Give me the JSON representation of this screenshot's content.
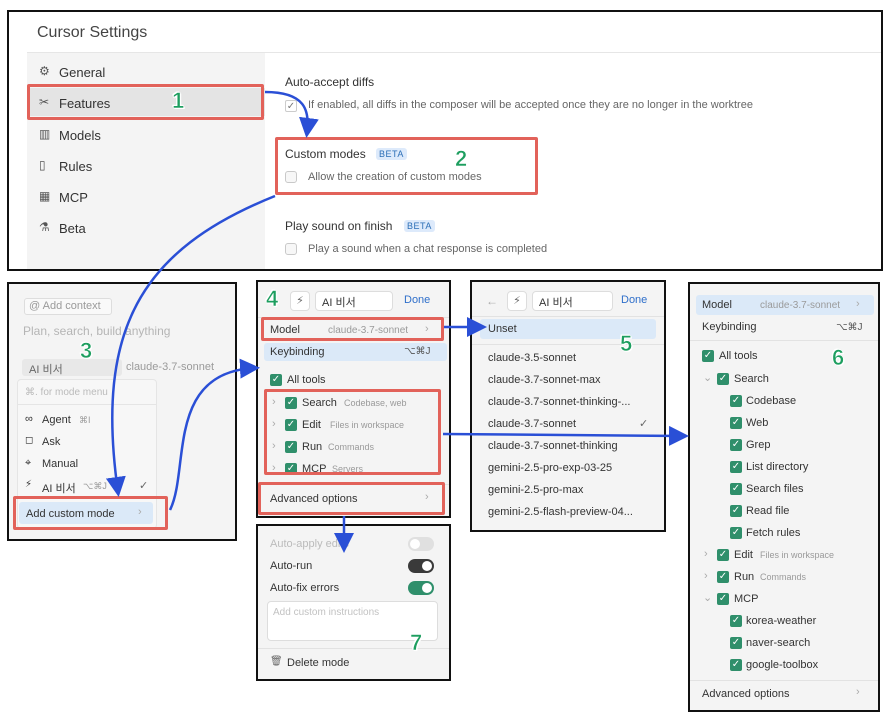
{
  "settings": {
    "title": "Cursor Settings",
    "sidebar": [
      {
        "icon": "⚙",
        "label": "General"
      },
      {
        "icon": "✂",
        "label": "Features"
      },
      {
        "icon": "▥",
        "label": "Models"
      },
      {
        "icon": "▯",
        "label": "Rules"
      },
      {
        "icon": "▦",
        "label": "MCP"
      },
      {
        "icon": "⚗",
        "label": "Beta"
      }
    ],
    "auto_accept": {
      "title": "Auto-accept diffs",
      "desc": "If enabled, all diffs in the composer will be accepted once they are no longer in the worktree"
    },
    "custom_modes": {
      "title": "Custom modes",
      "badge": "BETA",
      "desc": "Allow the creation of custom modes"
    },
    "play_sound": {
      "title": "Play sound on finish",
      "badge": "BETA",
      "desc": "Play a sound when a chat response is completed"
    }
  },
  "chat": {
    "add_context": "@ Add context",
    "placeholder": "Plan, search, build anything",
    "mode_button": "AI 비서",
    "model_button": "claude-3.7-sonnet",
    "menu_search": "⌘. for mode menu",
    "modes": [
      {
        "icon": "∞",
        "label": "Agent",
        "shortcut": "⌘I"
      },
      {
        "icon": "◻",
        "label": "Ask",
        "shortcut": ""
      },
      {
        "icon": "⌖",
        "label": "Manual",
        "shortcut": ""
      },
      {
        "icon": "⚡",
        "label": "AI 비서",
        "shortcut": "⌥⌘J"
      }
    ],
    "add_custom_mode": "Add custom mode"
  },
  "mode_editor": {
    "name": "AI 비서",
    "done": "Done",
    "model_label": "Model",
    "model_value": "claude-3.7-sonnet",
    "keybinding_label": "Keybinding",
    "keybinding_value": "⌥⌘J",
    "all_tools": "All tools",
    "tools": [
      {
        "label": "Search",
        "desc": "Codebase, web"
      },
      {
        "label": "Edit",
        "desc": "Files in workspace"
      },
      {
        "label": "Run",
        "desc": "Commands"
      },
      {
        "label": "MCP",
        "desc": "Servers"
      }
    ],
    "advanced": "Advanced options"
  },
  "model_picker": {
    "name": "AI 비서",
    "done": "Done",
    "unset": "Unset",
    "models": [
      "claude-3.5-sonnet",
      "claude-3.7-sonnet-max",
      "claude-3.7-sonnet-thinking-...",
      "claude-3.7-sonnet",
      "claude-3.7-sonnet-thinking",
      "gemini-2.5-pro-exp-03-25",
      "gemini-2.5-pro-max",
      "gemini-2.5-flash-preview-04..."
    ],
    "selected_index": 3
  },
  "advanced": {
    "auto_apply": "Auto-apply edits",
    "auto_run": "Auto-run",
    "auto_fix": "Auto-fix errors",
    "instructions_placeholder": "Add custom instructions",
    "delete": "Delete mode"
  },
  "tools_panel": {
    "model_label": "Model",
    "model_value": "claude-3.7-sonnet",
    "keybinding_label": "Keybinding",
    "keybinding_value": "⌥⌘J",
    "all_tools": "All tools",
    "search": "Search",
    "search_items": [
      "Codebase",
      "Web",
      "Grep",
      "List directory",
      "Search files",
      "Read file",
      "Fetch rules"
    ],
    "edit": "Edit",
    "edit_desc": "Files in workspace",
    "run": "Run",
    "run_desc": "Commands",
    "mcp": "MCP",
    "mcp_items": [
      "korea-weather",
      "naver-search",
      "google-toolbox"
    ],
    "advanced": "Advanced options"
  },
  "steps": [
    "1",
    "2",
    "3",
    "4",
    "5",
    "6",
    "7"
  ],
  "colors": {
    "accent_red": "#e2625a",
    "step_green": "#1d9e5f",
    "arrow_blue": "#2a4fd6",
    "check_green": "#2f8f6b"
  }
}
